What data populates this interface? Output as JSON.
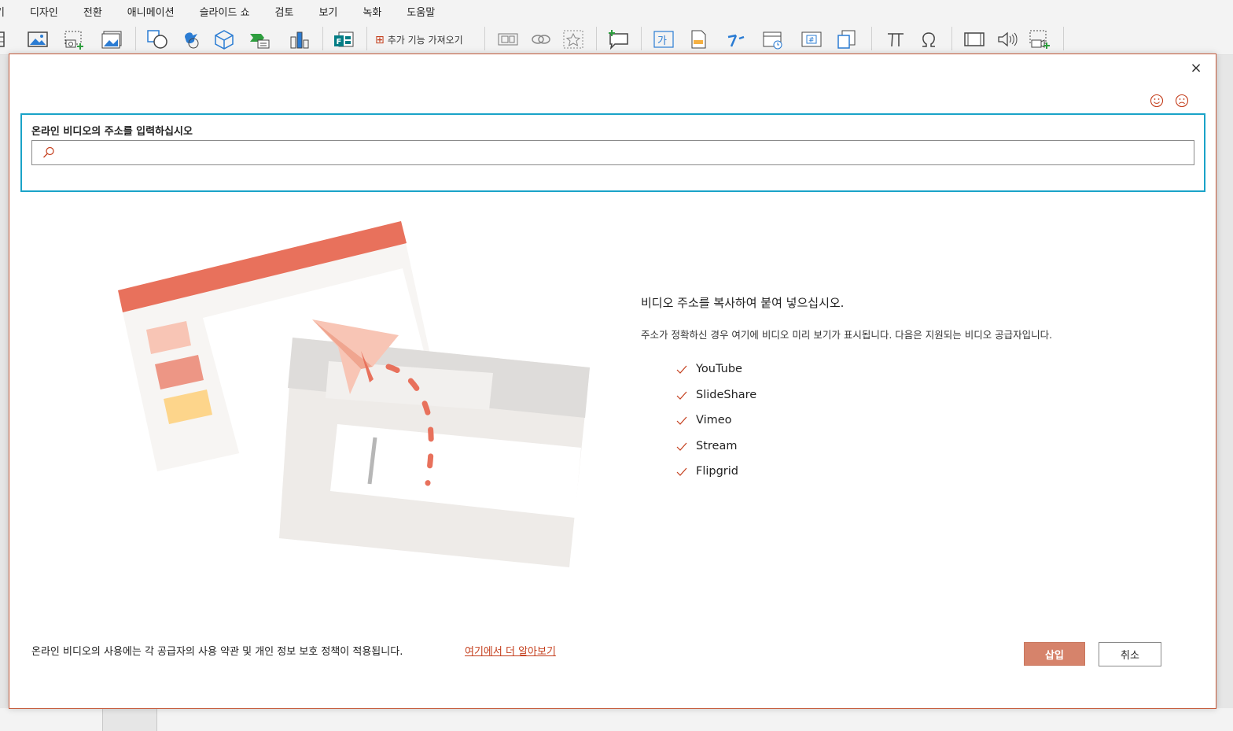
{
  "menu": {
    "items": [
      "기",
      "디자인",
      "전환",
      "애니메이션",
      "슬라이드 쇼",
      "검토",
      "보기",
      "녹화",
      "도움말"
    ]
  },
  "ribbon": {
    "addin_label": "추가 기능 가져오기",
    "icons": [
      "table-icon",
      "picture-icon",
      "screenshot-icon",
      "photo-album-icon",
      "shapes-icon",
      "icons-icon",
      "3d-models-icon",
      "smartart-icon",
      "chart-icon",
      "forms-icon",
      "zoom-icon",
      "link-icon",
      "action-icon",
      "comment-icon",
      "textbox-icon",
      "header-footer-icon",
      "wordart-icon",
      "date-time-icon",
      "slide-number-icon",
      "object-icon",
      "equation-icon",
      "symbol-icon",
      "video-icon",
      "audio-icon",
      "screen-recording-icon"
    ]
  },
  "dialog": {
    "close_symbol": "×",
    "url_label": "온라인 비디오의 주소를 입력하십시오",
    "url_value": "",
    "info_title": "비디오 주소를 복사하여 붙여 넣으십시오.",
    "info_desc": "주소가 정확하신 경우 여기에 비디오 미리 보기가 표시됩니다. 다음은 지원되는 비디오 공급자입니다.",
    "providers": [
      "YouTube",
      "SlideShare",
      "Vimeo",
      "Stream",
      "Flipgrid"
    ],
    "footer_text": "온라인 비디오의 사용에는 각 공급자의 사용 약관 및 개인 정보 보호 정책이 적용됩니다.",
    "footer_link": "여기에서 더 알아보기",
    "insert_button": "삽입",
    "cancel_button": "취소"
  },
  "colors": {
    "accent": "#c43e1c",
    "focus_border": "#1aa3c8",
    "insert_button_bg": "#d6836b"
  }
}
